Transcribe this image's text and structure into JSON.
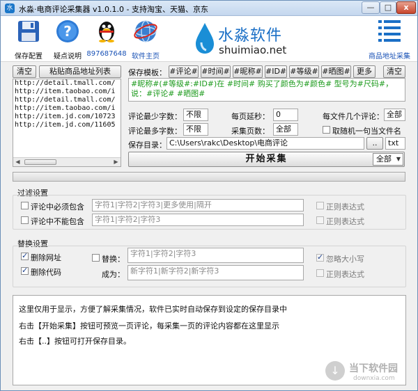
{
  "window": {
    "title": "水淼·电商评论采集器 v1.0.1.0 - 支持淘宝、天猫、京东",
    "min_label": "—",
    "max_label": "□",
    "close_label": "x",
    "app_icon_label": "水"
  },
  "toolbar": {
    "save_label": "保存配置",
    "help_label": "疑点说明",
    "qq_label": "897687648",
    "home_label": "软件主页",
    "logo_cn": "水淼软件",
    "logo_en": "shuimiao.net",
    "url_collect_label": "商品地址采集"
  },
  "left_panel": {
    "clear_label": "清空",
    "paste_label": "粘贴商品地址列表",
    "urls": [
      "http://detail.tmall.com/",
      "http://item.taobao.com/i",
      "http://detail.tmall.com/",
      "http://item.taobao.com/i",
      "http://item.jd.com/10723",
      "http://item.jd.com/11605"
    ]
  },
  "template": {
    "label": "保存模板：",
    "tags": [
      "#评论#",
      "#时间#",
      "#昵称#",
      "#ID#",
      "#等级#",
      "#晒图#"
    ],
    "more_label": "更多",
    "clear_label": "清空",
    "content": "#昵称#(#等级#:#ID#)在 #时间# 购买了颜色为#颜色# 型号为#尺码#，说：#评论# #晒图#"
  },
  "settings": {
    "min_words_label": "评论最少字数：",
    "min_words_value": "不限",
    "delay_label": "每页延秒：",
    "delay_value": "0",
    "per_file_label": "每文件几个评论：",
    "per_file_value": "全部",
    "max_words_label": "评论最多字数：",
    "max_words_value": "不限",
    "pages_label": "采集页数：",
    "pages_value": "全部",
    "random_label": "取随机一句当文件名",
    "dir_label": "保存目录：",
    "dir_value": "C:\\Users\\rakc\\Desktop\\电商评论",
    "browse_label": "..",
    "ext_value": "txt",
    "start_label": "开始采集",
    "mode_value": "全部"
  },
  "progress": {
    "value": 0
  },
  "filter": {
    "title": "过滤设置",
    "must_contain_label": "评论中必须包含",
    "must_contain_placeholder": "字符1|字符2|字符3|更多使用|隔开",
    "must_not_label": "评论中不能包含",
    "must_not_placeholder": "字符1|字符2|字符3",
    "regex_label_1": "正则表达式",
    "regex_label_2": "正则表达式"
  },
  "replace": {
    "title": "替换设置",
    "remove_url_label": "删除网址",
    "remove_code_label": "删除代码",
    "replace_label": "替换：",
    "replace_placeholder": "字符1|字符2|字符3",
    "to_label": "成为：",
    "to_placeholder": "新字符1|新字符2|新字符3",
    "ignore_case_label": "忽略大小写",
    "regex_label": "正则表达式"
  },
  "log": {
    "lines": [
      "这里仅用于显示，方便了解采集情况，软件已实时自动保存到设定的保存目录中",
      "右击【开始采集】按钮可预览一页评论，每采集一页的评论内容都在这里显示",
      "右击【..】按钮可打开保存目录。"
    ]
  },
  "watermark": {
    "cn": "当下软件园",
    "en": "downxia.com"
  }
}
